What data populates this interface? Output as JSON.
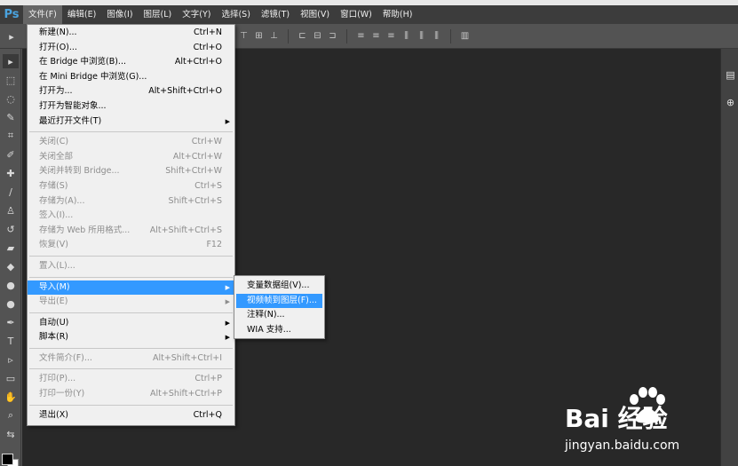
{
  "app": {
    "logo": "Ps"
  },
  "menubar": [
    {
      "label": "文件(F)",
      "active": true
    },
    {
      "label": "编辑(E)"
    },
    {
      "label": "图像(I)"
    },
    {
      "label": "图层(L)"
    },
    {
      "label": "文字(Y)"
    },
    {
      "label": "选择(S)"
    },
    {
      "label": "滤镜(T)"
    },
    {
      "label": "视图(V)"
    },
    {
      "label": "窗口(W)"
    },
    {
      "label": "帮助(H)"
    }
  ],
  "file_menu": {
    "items": [
      {
        "label": "新建(N)...",
        "shortcut": "Ctrl+N"
      },
      {
        "label": "打开(O)...",
        "shortcut": "Ctrl+O"
      },
      {
        "label": "在 Bridge 中浏览(B)...",
        "shortcut": "Alt+Ctrl+O"
      },
      {
        "label": "在 Mini Bridge 中浏览(G)...",
        "shortcut": ""
      },
      {
        "label": "打开为...",
        "shortcut": "Alt+Shift+Ctrl+O"
      },
      {
        "label": "打开为智能对象...",
        "shortcut": ""
      },
      {
        "label": "最近打开文件(T)",
        "shortcut": "",
        "submenu": true
      },
      {
        "label": "关闭(C)",
        "shortcut": "Ctrl+W",
        "disabled": true
      },
      {
        "label": "关闭全部",
        "shortcut": "Alt+Ctrl+W",
        "disabled": true
      },
      {
        "label": "关闭并转到 Bridge...",
        "shortcut": "Shift+Ctrl+W",
        "disabled": true
      },
      {
        "label": "存储(S)",
        "shortcut": "Ctrl+S",
        "disabled": true
      },
      {
        "label": "存储为(A)...",
        "shortcut": "Shift+Ctrl+S",
        "disabled": true
      },
      {
        "label": "签入(I)...",
        "shortcut": "",
        "disabled": true
      },
      {
        "label": "存储为 Web 所用格式...",
        "shortcut": "Alt+Shift+Ctrl+S",
        "disabled": true
      },
      {
        "label": "恢复(V)",
        "shortcut": "F12",
        "disabled": true
      },
      {
        "label": "置入(L)...",
        "shortcut": "",
        "disabled": true
      },
      {
        "label": "导入(M)",
        "shortcut": "",
        "submenu": true,
        "highlight": true
      },
      {
        "label": "导出(E)",
        "shortcut": "",
        "submenu": true,
        "disabled": true
      },
      {
        "label": "自动(U)",
        "shortcut": "",
        "submenu": true
      },
      {
        "label": "脚本(R)",
        "shortcut": "",
        "submenu": true
      },
      {
        "label": "文件简介(F)...",
        "shortcut": "Alt+Shift+Ctrl+I",
        "disabled": true
      },
      {
        "label": "打印(P)...",
        "shortcut": "Ctrl+P",
        "disabled": true
      },
      {
        "label": "打印一份(Y)",
        "shortcut": "Alt+Shift+Ctrl+P",
        "disabled": true
      },
      {
        "label": "退出(X)",
        "shortcut": "Ctrl+Q"
      }
    ]
  },
  "import_submenu": {
    "items": [
      {
        "label": "变量数据组(V)..."
      },
      {
        "label": "视频帧到图层(F)...",
        "highlight": true
      },
      {
        "label": "注释(N)..."
      },
      {
        "label": "WIA 支持..."
      }
    ]
  },
  "watermark": {
    "logo_text": "Bai  经验",
    "url": "jingyan.baidu.com"
  },
  "colors": {
    "menubar_bg": "#3c3c3c",
    "workspace_bg": "#535353",
    "canvas_bg": "#282828",
    "highlight": "#3399ff",
    "menu_bg": "#f0f0f0",
    "disabled_text": "#8d8d8d",
    "ps_blue": "#4aa3df"
  }
}
